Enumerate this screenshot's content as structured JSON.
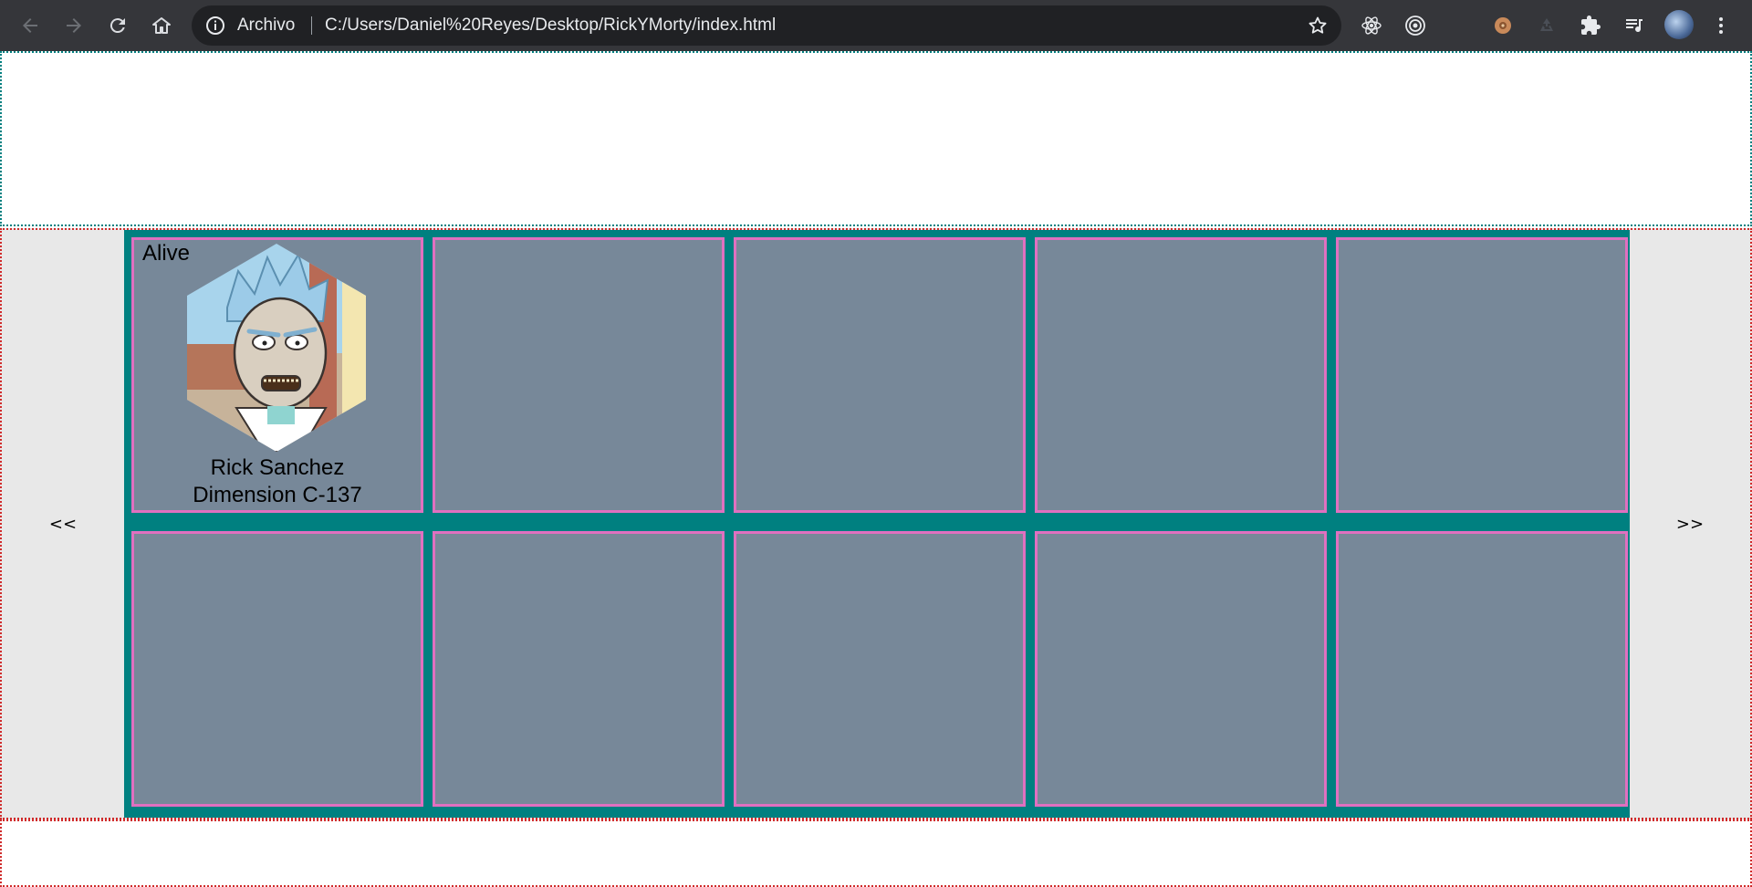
{
  "browser": {
    "scheme_label": "Archivo",
    "url": "C:/Users/Daniel%20Reyes/Desktop/RickYMorty/index.html"
  },
  "colors": {
    "grid_background": "#008080",
    "card_background": "#778899",
    "card_border": "#e070c0",
    "side_background": "#e8e8e8"
  },
  "pagination": {
    "prev_label": "<<",
    "next_label": ">>"
  },
  "cards": [
    {
      "status": "Alive",
      "name": "Rick Sanchez",
      "origin": "Dimension C-137"
    },
    {},
    {},
    {},
    {},
    {},
    {},
    {},
    {},
    {}
  ]
}
